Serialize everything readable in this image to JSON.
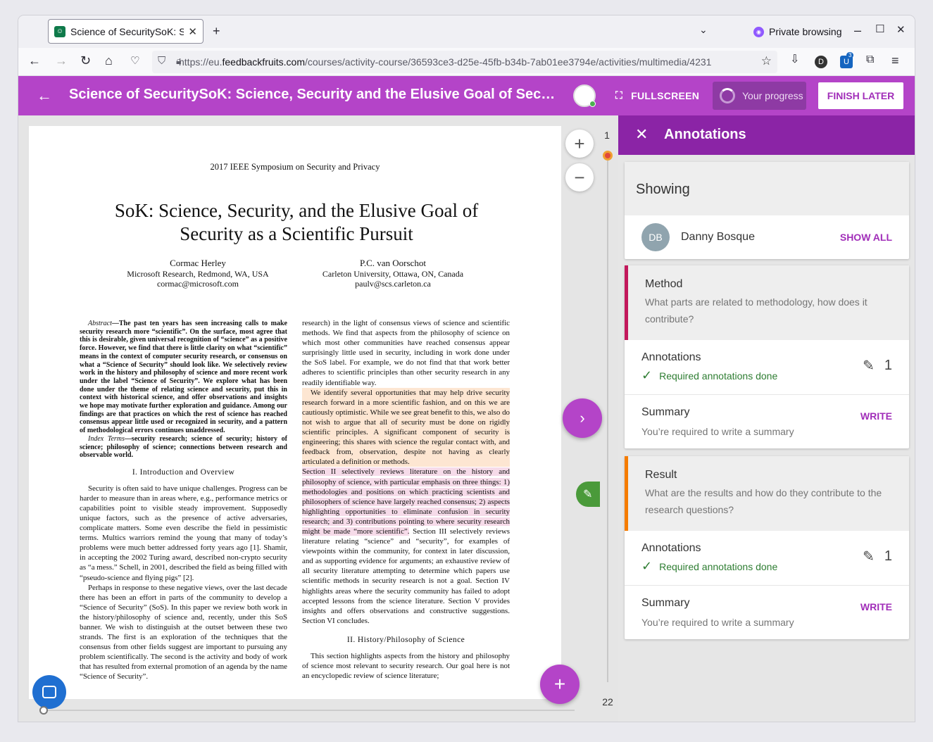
{
  "browser": {
    "tab_title": "Science of SecuritySoK: Scie",
    "new_tab": "+",
    "private_label": "Private browsing",
    "url_prefix": "https://eu.",
    "url_domain": "feedbackfruits.com",
    "url_path": "/courses/activity-course/36593ce3-d25e-45fb-b34b-7ab01ee3794e/activities/multimedia/4231",
    "ext_badge": "3",
    "ext_letter": "D"
  },
  "app": {
    "title": "Science of SecuritySoK: Science, Security and the Elusive Goal of Securit...",
    "fullscreen": "FULLSCREEN",
    "progress": "Your progress",
    "finish_later": "FINISH LATER"
  },
  "viewer": {
    "page_first": "1",
    "page_last": "22",
    "zoom_in": "+",
    "zoom_out": "−",
    "next": "›",
    "add": "+"
  },
  "paper": {
    "conference": "2017 IEEE Symposium on Security and Privacy",
    "title": "SoK: Science, Security, and the Elusive Goal of Security as a Scientific Pursuit",
    "authors": [
      {
        "name": "Cormac Herley",
        "affil": "Microsoft Research, Redmond, WA, USA",
        "email": "cormac@microsoft.com"
      },
      {
        "name": "P.C. van Oorschot",
        "affil": "Carleton University, Ottawa, ON, Canada",
        "email": "paulv@scs.carleton.ca"
      }
    ],
    "abstract_label": "Abstract",
    "abstract": "—The past ten years has seen increasing calls to make security research more “scientific”. On the surface, most agree that this is desirable, given universal recognition of “science” as a positive force. However, we find that there is little clarity on what “scientific” means in the context of computer security research, or consensus on what a “Science of Security” should look like. We selectively review work in the history and philosophy of science and more recent work under the label “Science of Security”. We explore what has been done under the theme of relating science and security, put this in context with historical science, and offer observations and insights we hope may motivate further exploration and guidance. Among our findings are that practices on which the rest of science has reached consensus appear little used or recognized in security, and a pattern of methodological errors continues unaddressed.",
    "index_label": "Index Terms",
    "index_terms": "—security research; science of security; history of science; philosophy of science; connections between research and observable world.",
    "sec1": "I. Introduction and Overview",
    "p1": "Security is often said to have unique challenges. Progress can be harder to measure than in areas where, e.g., performance metrics or capabilities point to visible steady improvement. Supposedly unique factors, such as the presence of active adversaries, complicate matters. Some even describe the field in pessimistic terms. Multics warriors remind the young that many of today’s problems were much better addressed forty years ago [1]. Shamir, in accepting the 2002 Turing award, described non-crypto security as “a mess.” Schell, in 2001, described the field as being filled with “pseudo-science and flying pigs” [2].",
    "p2": "Perhaps in response to these negative views, over the last decade there has been an effort in parts of the community to develop a “Science of Security” (SoS). In this paper we review both work in the history/philosophy of science and, recently, under this SoS banner. We wish to distinguish at the outset between these two strands. The first is an exploration of the techniques that the consensus from other fields suggest are important to pursuing any problem scientifically. The second is the activity and body of work that has resulted from external promotion of an agenda by the name “Science of Security”.",
    "r1": "research) in the light of consensus views of science and scientific methods. We find that aspects from the philosophy of science on which most other communities have reached consensus appear surprisingly little used in security, including in work done under the SoS label. For example, we do not find that that work better adheres to scientific principles than other security research in any readily identifiable way.",
    "r2": "We identify several opportunities that may help drive security research forward in a more scientific fashion, and on this we are cautiously optimistic. While we see great benefit to this, we also do not wish to argue that all of security must be done on rigidly scientific principles. A significant component of security is engineering; this shares with science the regular contact with, and feedback from, observation, despite not having as clearly articulated a definition or methods.",
    "r3": "Section II selectively reviews literature on the history and philosophy of science, with particular emphasis on three things: 1) methodologies and positions on which practicing scientists and philosophers of science have largely reached consensus; 2) aspects highlighting opportunities to eliminate confusion in security research; and 3) contributions pointing to where security research might be made “more scientific”.",
    "r4": "Section III selectively reviews literature relating “science” and “security”, for examples of viewpoints within the community, for context in later discussion, and as supporting evidence for arguments; an exhaustive review of all security literature attempting to determine which papers use scientific methods in security research is not a goal. Section IV highlights areas where the security community has failed to adopt accepted lessons from the science literature. Section V provides insights and offers observations and constructive suggestions. Section VI concludes.",
    "sec2": "II. History/Philosophy of Science",
    "r5": "This section highlights aspects from the history and philosophy of science most relevant to security research. Our goal here is not an encyclopedic review of science literature;"
  },
  "panel": {
    "title": "Annotations",
    "showing": "Showing",
    "user_initials": "DB",
    "user_name": "Danny Bosque",
    "show_all": "SHOW ALL",
    "questions": [
      {
        "title": "Method",
        "desc": "What parts are related to methodology, how does it contribute?",
        "color": "#c2185b",
        "annotations_label": "Annotations",
        "status": "Required annotations done",
        "count": "1",
        "summary_label": "Summary",
        "write": "WRITE",
        "summary_hint": "You’re required to write a summary"
      },
      {
        "title": "Result",
        "desc": "What are the results and how do they contribute to the research questions?",
        "color": "#f57c00",
        "annotations_label": "Annotations",
        "status": "Required annotations done",
        "count": "1",
        "summary_label": "Summary",
        "write": "WRITE",
        "summary_hint": "You’re required to write a summary"
      }
    ]
  }
}
